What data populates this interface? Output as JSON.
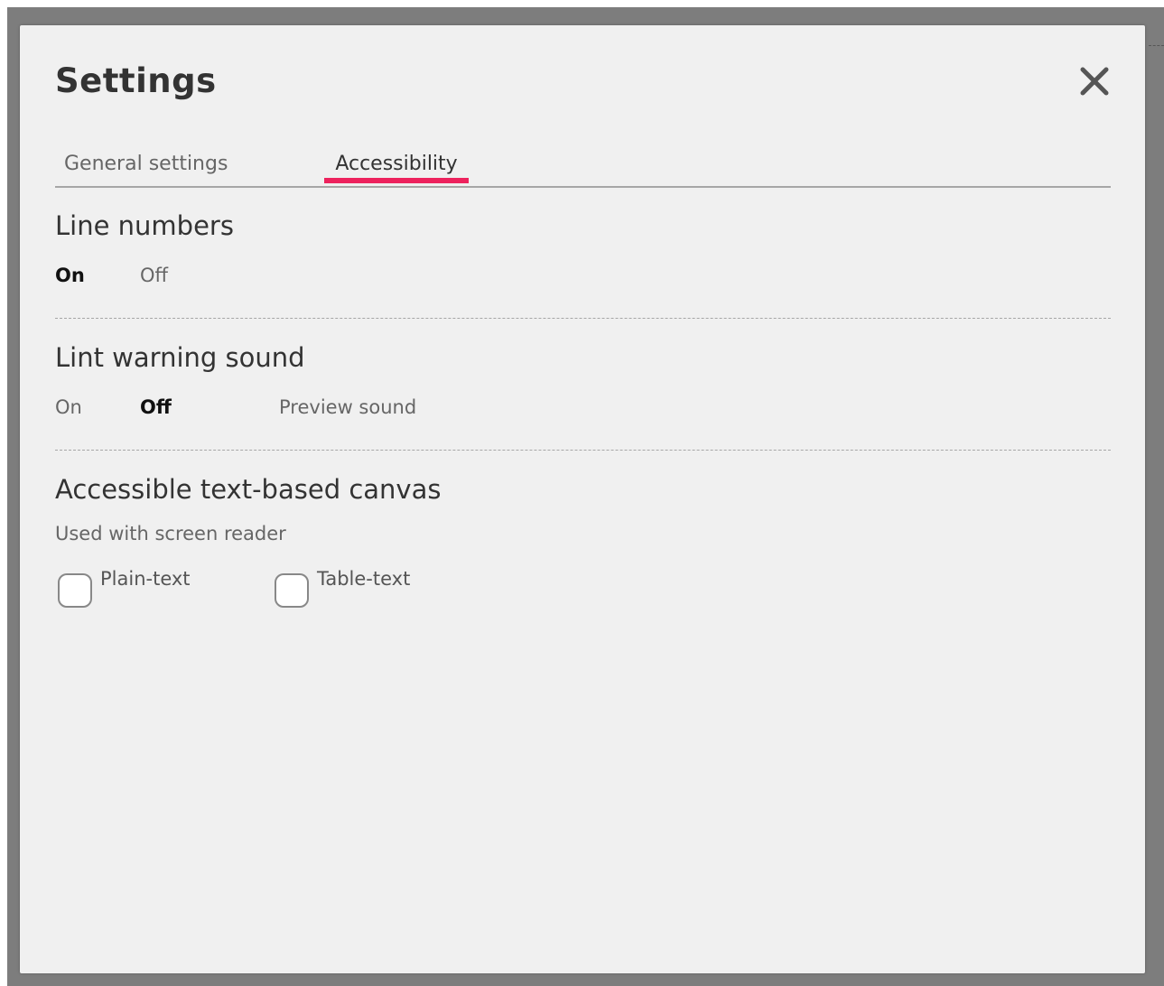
{
  "dialog": {
    "title": "Settings",
    "close_icon": "close-icon"
  },
  "tabs": [
    {
      "label": "General settings",
      "active": false
    },
    {
      "label": "Accessibility",
      "active": true
    }
  ],
  "accent_color": "#ed225d",
  "sections": {
    "line_numbers": {
      "title": "Line numbers",
      "on_label": "On",
      "off_label": "Off",
      "selected": "On"
    },
    "lint_sound": {
      "title": "Lint warning sound",
      "on_label": "On",
      "off_label": "Off",
      "preview_label": "Preview sound",
      "selected": "Off"
    },
    "text_canvas": {
      "title": "Accessible text-based canvas",
      "subtitle": "Used with screen reader",
      "options": [
        {
          "label": "Plain-text",
          "checked": false
        },
        {
          "label": "Table-text",
          "checked": false
        }
      ]
    }
  }
}
